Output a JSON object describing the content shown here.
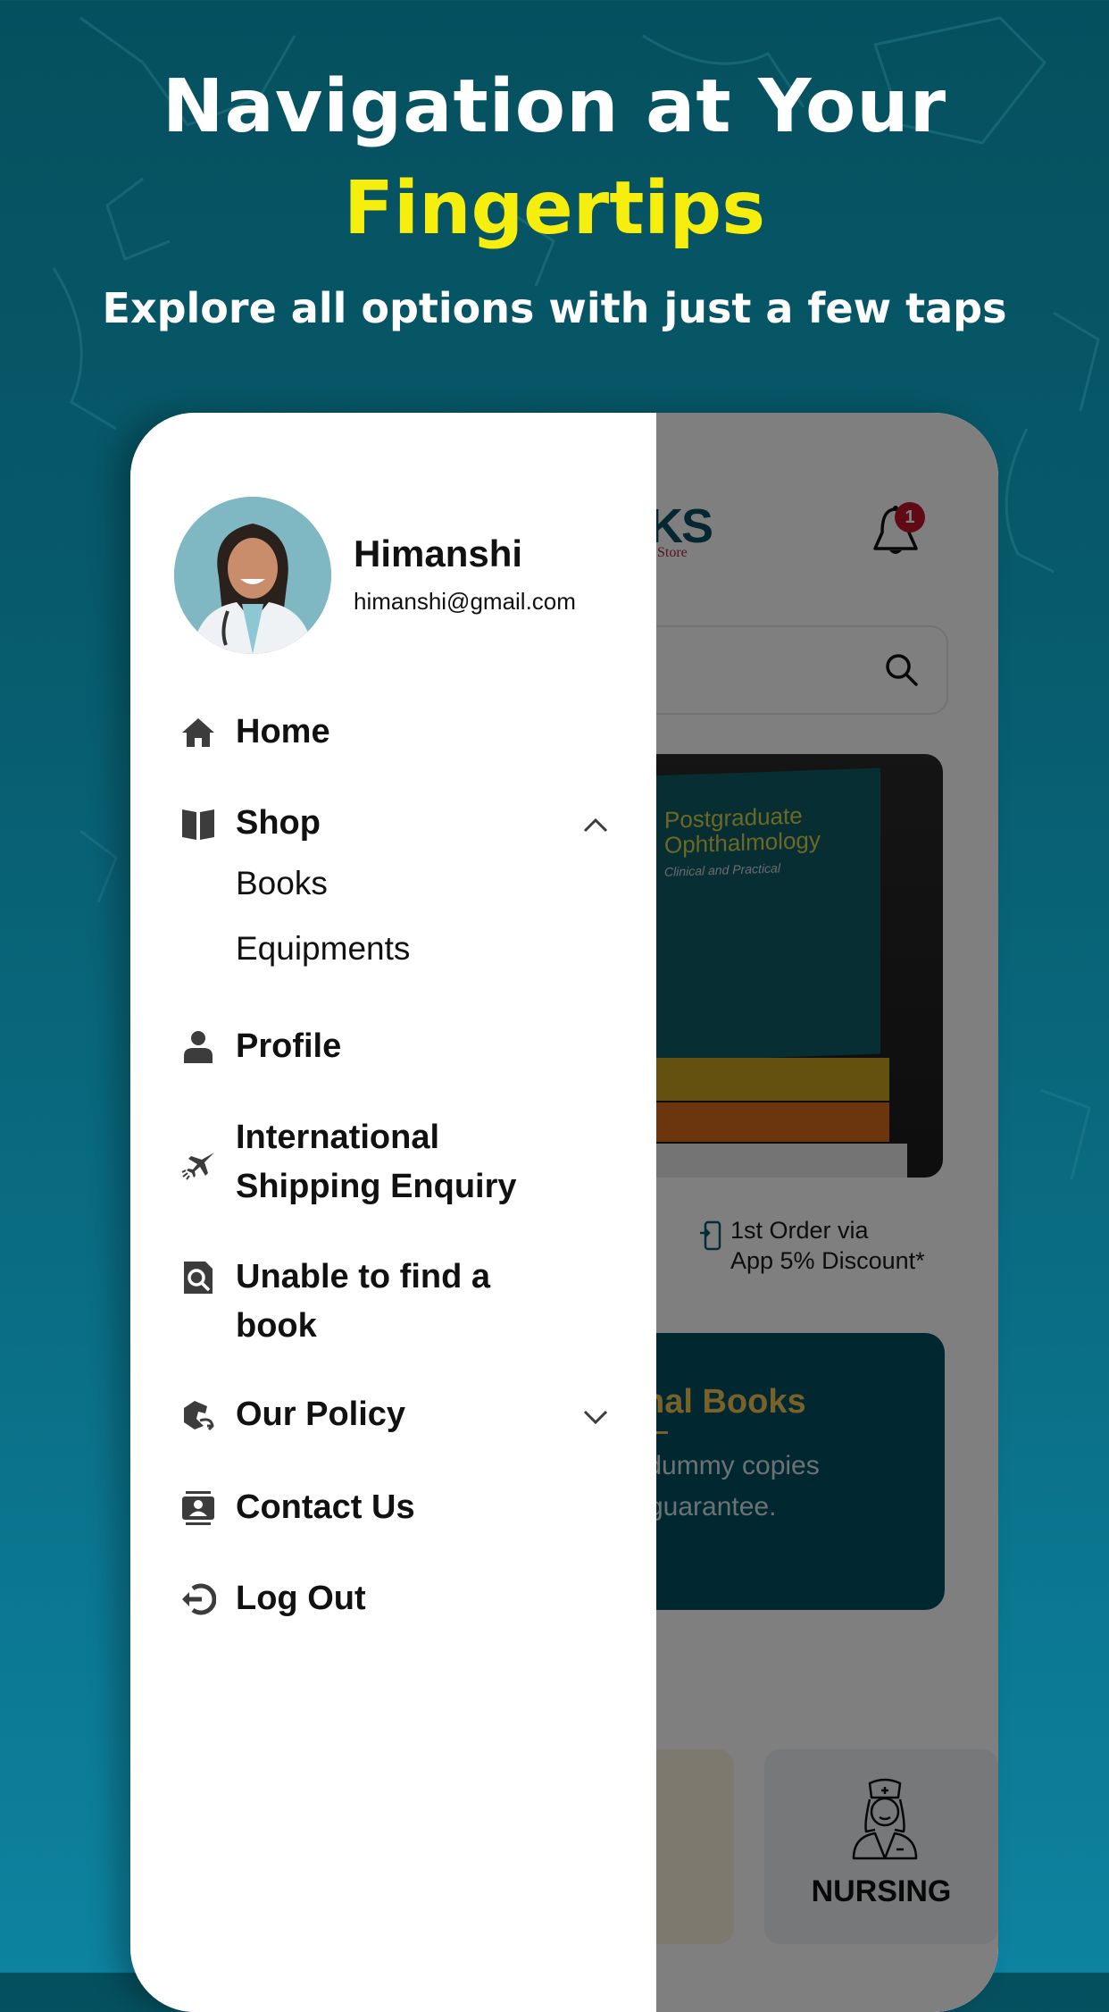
{
  "hero": {
    "title_line1": "Navigation at Your",
    "title_line2": "Fingertips",
    "subtitle": "Explore all options with just a few taps",
    "highlight_color": "#f6ee0c"
  },
  "drawer": {
    "user": {
      "name": "Himanshi",
      "email": "himanshi@gmail.com"
    },
    "menu": [
      {
        "label": "Home",
        "icon": "home-icon"
      },
      {
        "label": "Shop",
        "icon": "open-book-icon",
        "expanded": true,
        "children": [
          {
            "label": "Books"
          },
          {
            "label": "Equipments"
          }
        ]
      },
      {
        "label": "Profile",
        "icon": "user-icon"
      },
      {
        "label_line1": "International",
        "label_line2": "Shipping Enquiry",
        "icon": "airplane-icon"
      },
      {
        "label_line1": "Unable to find a",
        "label_line2": "book",
        "icon": "search-document-icon"
      },
      {
        "label": "Our Policy",
        "icon": "policy-hand-icon",
        "expanded": false
      },
      {
        "label": "Contact Us",
        "icon": "contact-card-icon"
      },
      {
        "label": "Log Out",
        "icon": "logout-icon"
      }
    ]
  },
  "background_app": {
    "logo_partial": "KS",
    "logo_sub_partial": "Store",
    "notification_count": "1",
    "banner_book_title": "Postgraduate Ophthalmology",
    "banner_book_subtitle": "Clinical and Practical",
    "promo_dot": ".",
    "promo_line1": "1st Order via",
    "promo_line2": "App 5% Discount*",
    "notice_title_partial": "nal Books",
    "notice_line1_partial": "/dummy copies",
    "notice_line2_partial": "guarantee.",
    "category_tile_label": "NURSING",
    "badge_color": "#c0142c",
    "notice_bg": "#035163",
    "notice_title_color": "#f0c451"
  }
}
